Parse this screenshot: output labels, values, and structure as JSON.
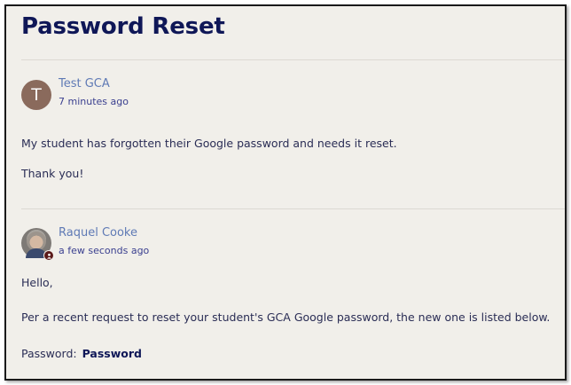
{
  "ticket": {
    "title": "Password Reset"
  },
  "comments": [
    {
      "avatar_letter": "T",
      "author": "Test GCA",
      "time": "7 minutes ago",
      "lines": [
        "My student has forgotten their Google password and needs it reset.",
        "Thank you!"
      ]
    },
    {
      "author": "Raquel Cooke",
      "time": "a few seconds ago",
      "lines": [
        "Hello,",
        "Per a recent request to reset your student's GCA Google password, the new one is listed below."
      ],
      "password_label": "Password:",
      "password_value": "Password"
    }
  ],
  "colors": {
    "title": "#0f1757",
    "author_link": "#5f7ab5",
    "background": "#f1efea"
  }
}
